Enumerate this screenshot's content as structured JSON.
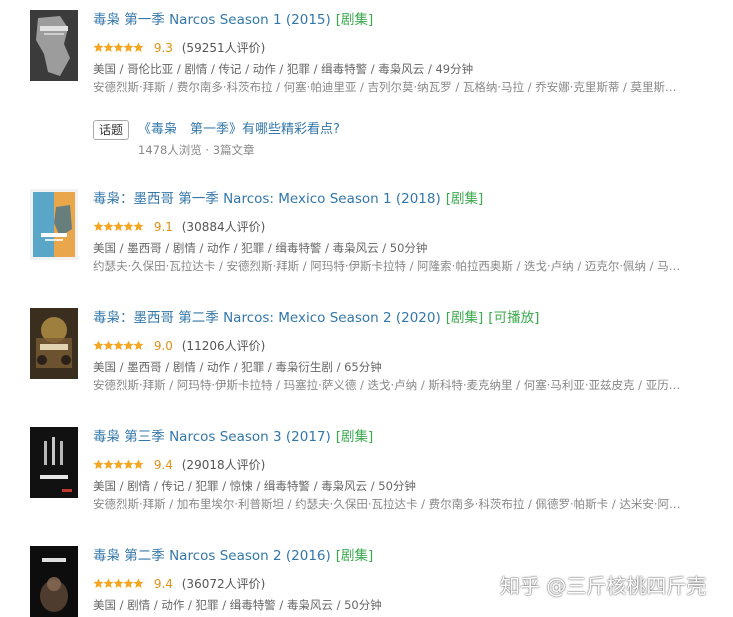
{
  "items": [
    {
      "title": "毒枭 第一季 Narcos Season 1 (2015)",
      "tags": [
        "[剧集]"
      ],
      "score": "9.3",
      "votes": "(59251人评价)",
      "meta": "美国 / 哥伦比亚 / 剧情 / 传记 / 动作 / 犯罪 / 缉毒特警 / 毒枭风云 / 49分钟",
      "cast": "安德烈斯·拜斯 / 费尔南多·科茨布拉 / 何塞·帕迪里亚 / 吉列尔莫·纳瓦罗 / 瓦格纳·马拉 / 乔安娜·克里斯蒂 / 莫里斯…"
    },
    {
      "title": "毒枭：墨西哥 第一季 Narcos: Mexico Season 1 (2018)",
      "tags": [
        "[剧集]"
      ],
      "score": "9.1",
      "votes": "(30884人评价)",
      "meta": "美国 / 墨西哥 / 剧情 / 动作 / 犯罪 / 缉毒特警 / 毒枭风云 / 50分钟",
      "cast": "约瑟夫·久保田·瓦拉达卡 / 安德烈斯·拜斯 / 阿玛特·伊斯卡拉特 / 阿隆索·帕拉西奥斯 / 迭戈·卢纳 / 迈克尔·佩纳 / 马…"
    },
    {
      "title": "毒枭：墨西哥 第二季 Narcos: Mexico Season 2 (2020)",
      "tags": [
        "[剧集]",
        "[可播放]"
      ],
      "score": "9.0",
      "votes": "(11206人评价)",
      "meta": "美国 / 墨西哥 / 剧情 / 动作 / 犯罪 / 毒枭衍生剧 / 65分钟",
      "cast": "安德烈斯·拜斯 / 阿玛特·伊斯卡拉特 / 玛塞拉·萨义德 / 迭戈·卢纳 / 斯科特·麦克纳里 / 何塞·马利亚·亚兹皮克 / 亚历…"
    },
    {
      "title": "毒枭 第三季 Narcos Season 3 (2017)",
      "tags": [
        "[剧集]"
      ],
      "score": "9.4",
      "votes": "(29018人评价)",
      "meta": "美国 / 剧情 / 传记 / 犯罪 / 惊悚 / 缉毒特警 / 毒枭风云 / 50分钟",
      "cast": "安德烈斯·拜斯 / 加布里埃尔·利普斯坦 / 约瑟夫·久保田·瓦拉达卡 / 费尔南多·科茨布拉 / 佩德罗·帕斯卡 / 达米安·阿…"
    },
    {
      "title": "毒枭 第二季 Narcos Season 2 (2016)",
      "tags": [
        "[剧集]"
      ],
      "score": "9.4",
      "votes": "(36072人评价)",
      "meta": "美国 / 剧情 / 动作 / 犯罪 / 缉毒特警 / 毒枭风云 / 50分钟",
      "cast": ""
    }
  ],
  "topic": {
    "badge": "话题",
    "title": "《毒枭　第一季》有哪些精彩看点?",
    "stats": "1478人浏览 · 3篇文章"
  },
  "watermark": "知乎 @三斤核桃四斤壳",
  "colors": {
    "link": "#3377aa",
    "tag": "#3ba94d",
    "star": "#f5a623",
    "score": "#e09015"
  },
  "icons": {
    "star": "star-icon",
    "half_star": "half-star-icon"
  }
}
